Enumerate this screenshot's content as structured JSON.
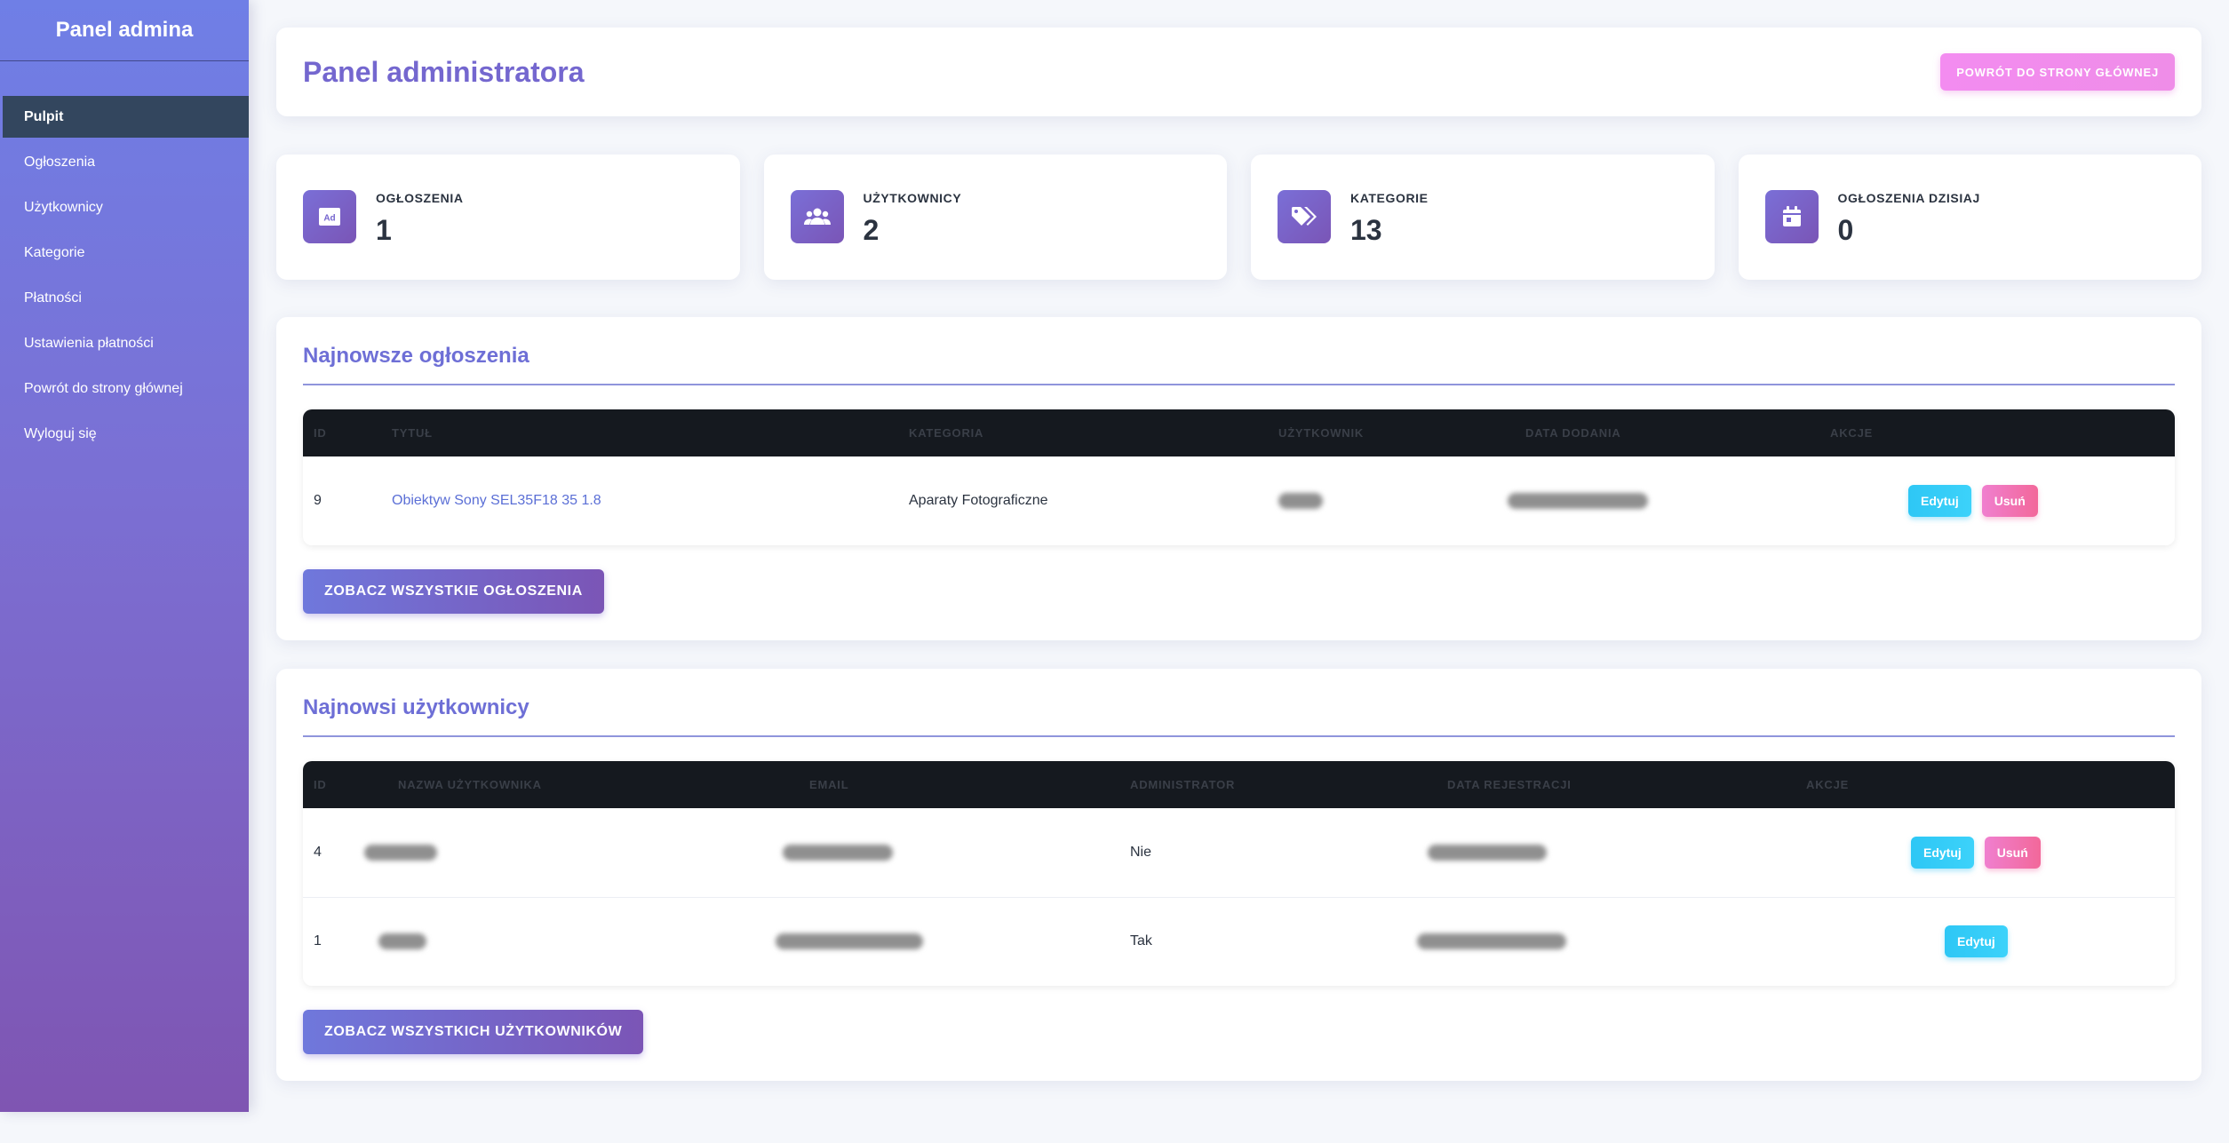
{
  "sidebar": {
    "brand": "Panel admina",
    "items": [
      {
        "label": "Pulpit",
        "active": true
      },
      {
        "label": "Ogłoszenia"
      },
      {
        "label": "Użytkownicy"
      },
      {
        "label": "Kategorie"
      },
      {
        "label": "Płatności"
      },
      {
        "label": "Ustawienia płatności"
      },
      {
        "label": "Powrót do strony głównej"
      },
      {
        "label": "Wyloguj się"
      }
    ]
  },
  "header": {
    "title": "Panel administratora",
    "home_button": "POWRÓT DO STRONY GŁÓWNEJ"
  },
  "stats": [
    {
      "label": "OGŁOSZENIA",
      "value": "1",
      "icon": "ad-icon"
    },
    {
      "label": "UŻYTKOWNICY",
      "value": "2",
      "icon": "users-icon"
    },
    {
      "label": "KATEGORIE",
      "value": "13",
      "icon": "tags-icon"
    },
    {
      "label": "OGŁOSZENIA DZISIAJ",
      "value": "0",
      "icon": "calendar-icon"
    }
  ],
  "ads_section": {
    "title": "Najnowsze ogłoszenia",
    "columns": [
      "ID",
      "TYTUŁ",
      "KATEGORIA",
      "UŻYTKOWNIK",
      "DATA DODANIA",
      "AKCJE"
    ],
    "rows": [
      {
        "id": "9",
        "title": "Obiektyw Sony SEL35F18 35 1.8",
        "category": "Aparaty Fotograficzne"
      }
    ],
    "edit_label": "Edytuj",
    "delete_label": "Usuń",
    "view_all": "ZOBACZ WSZYSTKIE OGŁOSZENIA"
  },
  "users_section": {
    "title": "Najnowsi użytkownicy",
    "columns": [
      "ID",
      "NAZWA UŻYTKOWNIKA",
      "EMAIL",
      "ADMINISTRATOR",
      "DATA REJESTRACJI",
      "AKCJE"
    ],
    "rows": [
      {
        "id": "4",
        "admin": "Nie"
      },
      {
        "id": "1",
        "admin": "Tak"
      }
    ],
    "edit_label": "Edytuj",
    "delete_label": "Usuń",
    "view_all": "ZOBACZ WSZYSTKICH UŻYTKOWNIKÓW"
  },
  "colors": {
    "accent": "#7467cf",
    "sidebar_active": "#33465e",
    "table_header": "#15191f",
    "edit": "#2ec7f5",
    "delete": "#f2689a"
  }
}
